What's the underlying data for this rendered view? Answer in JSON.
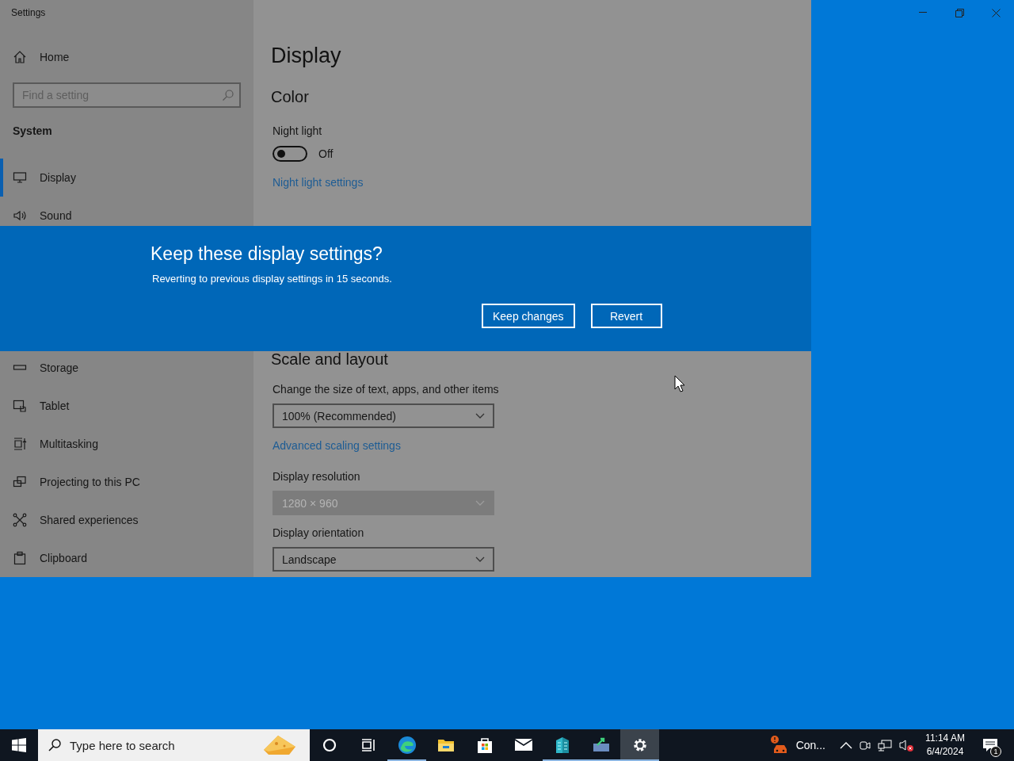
{
  "window": {
    "title": "Settings"
  },
  "sidebar": {
    "home": "Home",
    "search": {
      "placeholder": "Find a setting"
    },
    "section": "System",
    "items_top": [
      {
        "label": "Display",
        "kind": "display",
        "selected": true
      },
      {
        "label": "Sound",
        "kind": "sound",
        "selected": false
      }
    ],
    "items_bottom": [
      {
        "label": "Storage",
        "kind": "storage",
        "selected": false
      },
      {
        "label": "Tablet",
        "kind": "tablet",
        "selected": false
      },
      {
        "label": "Multitasking",
        "kind": "multitasking",
        "selected": false
      },
      {
        "label": "Projecting to this PC",
        "kind": "projecting",
        "selected": false
      },
      {
        "label": "Shared experiences",
        "kind": "shared",
        "selected": false
      },
      {
        "label": "Clipboard",
        "kind": "clipboard",
        "selected": false
      }
    ]
  },
  "content": {
    "title": "Display",
    "color_section": {
      "heading": "Color",
      "night_light": {
        "label": "Night light",
        "on": false,
        "state_text": "Off"
      },
      "link": "Night light settings"
    },
    "scale_section": {
      "heading": "Scale and layout",
      "items": [
        {
          "kind": "dropdown",
          "label": "Change the size of text, apps, and other items",
          "value": "100% (Recommended)",
          "disabled": false
        },
        {
          "kind": "link",
          "text": "Advanced scaling settings"
        },
        {
          "kind": "dropdown",
          "label": "Display resolution",
          "value": "1280 × 960",
          "disabled": true
        },
        {
          "kind": "dropdown",
          "label": "Display orientation",
          "value": "Landscape",
          "disabled": false
        }
      ]
    }
  },
  "dialog": {
    "title": "Keep these display settings?",
    "message": "Reverting to previous display settings in 15 seconds.",
    "buttons": [
      "Keep changes",
      "Revert"
    ]
  },
  "taskbar": {
    "search_placeholder": "Type here to search",
    "apps": [
      {
        "kind": "cortana",
        "running": false,
        "active": false
      },
      {
        "kind": "taskview",
        "running": false,
        "active": false
      },
      {
        "kind": "edge",
        "running": true,
        "active": false
      },
      {
        "kind": "explorer",
        "running": false,
        "active": false
      },
      {
        "kind": "store",
        "running": false,
        "active": false
      },
      {
        "kind": "mail",
        "running": false,
        "active": false
      },
      {
        "kind": "building",
        "running": true,
        "active": false
      },
      {
        "kind": "upload",
        "running": true,
        "active": false
      },
      {
        "kind": "settings",
        "running": true,
        "active": true
      }
    ],
    "tray": {
      "status_text": "Con...",
      "time": "11:14 AM",
      "date": "6/4/2024",
      "notification_count": "1"
    }
  }
}
